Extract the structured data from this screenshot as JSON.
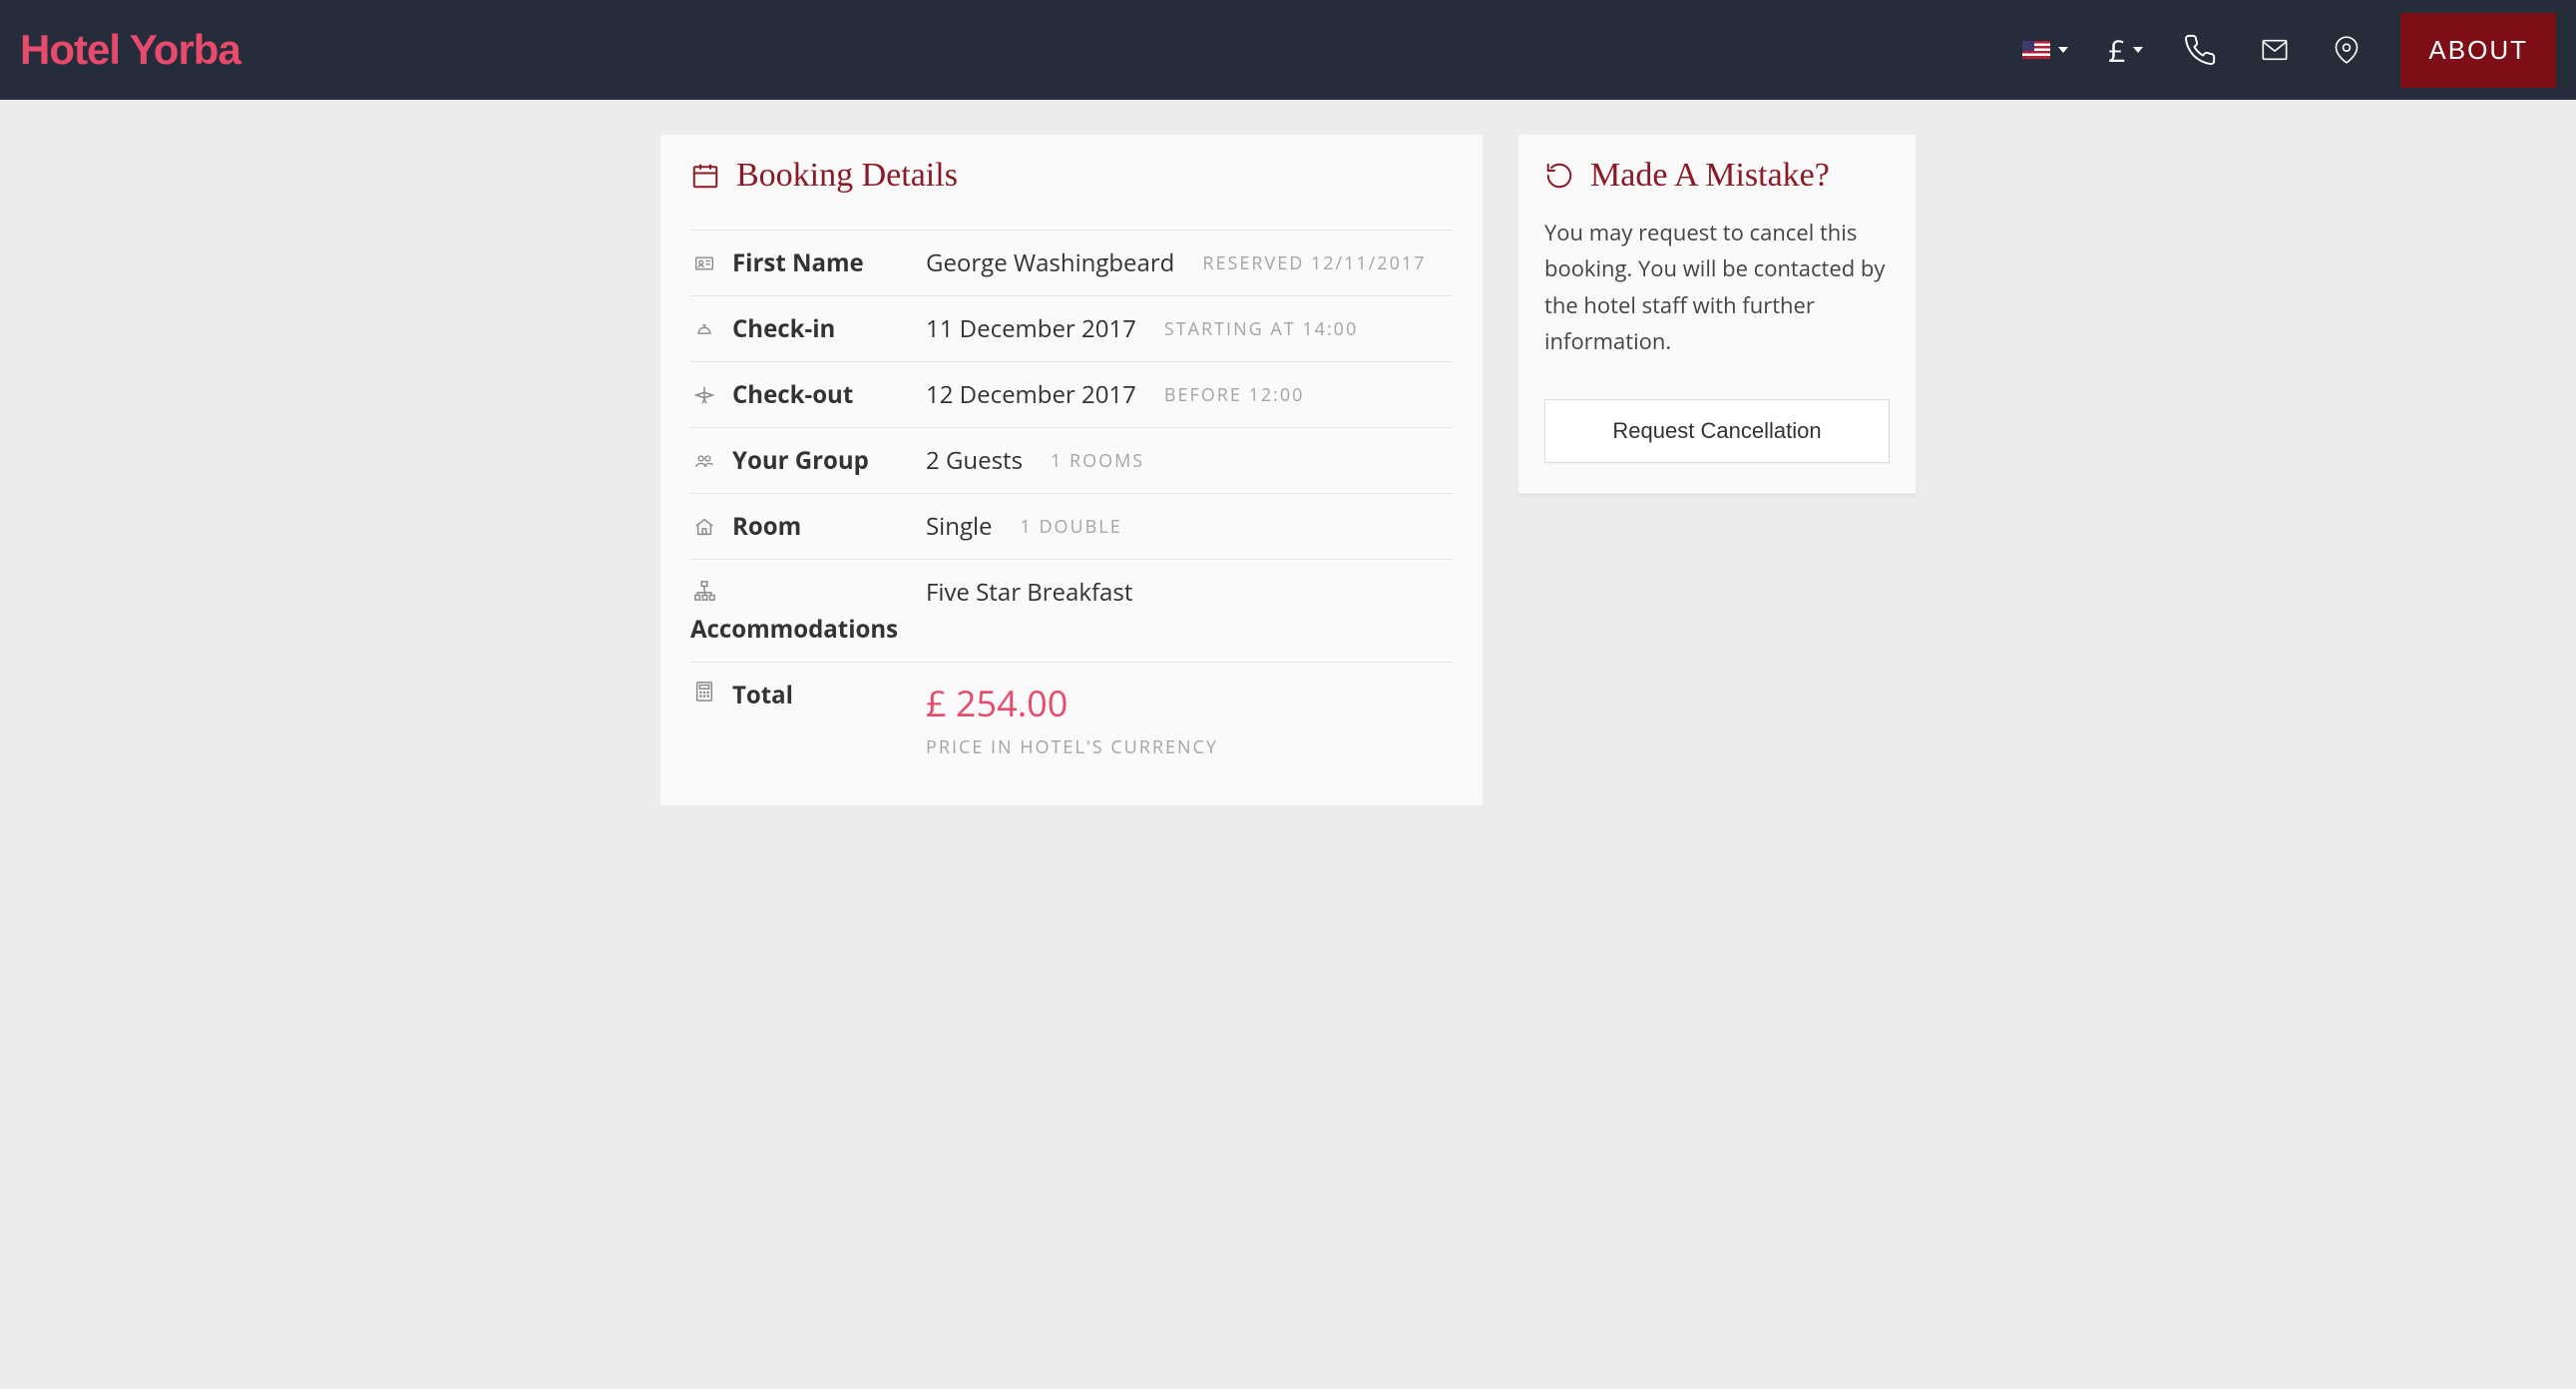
{
  "header": {
    "logo": "Hotel Yorba",
    "currency_symbol": "£",
    "about_label": "ABOUT"
  },
  "booking": {
    "title": "Booking Details",
    "rows": {
      "first_name": {
        "label": "First Name",
        "value": "George Washingbeard",
        "sub": "RESERVED 12/11/2017"
      },
      "check_in": {
        "label": "Check-in",
        "value": "11 December 2017",
        "sub": "STARTING AT 14:00"
      },
      "check_out": {
        "label": "Check-out",
        "value": "12 December 2017",
        "sub": "BEFORE 12:00"
      },
      "group": {
        "label": "Your Group",
        "value": "2 Guests",
        "sub": "1 ROOMS"
      },
      "room": {
        "label": "Room",
        "value": "Single",
        "sub": "1 DOUBLE"
      },
      "accommodations": {
        "label": "Accommodations",
        "value": "Five Star Breakfast"
      },
      "total": {
        "label": "Total",
        "value": "£ 254.00",
        "note": "PRICE IN HOTEL'S CURRENCY"
      }
    }
  },
  "mistake": {
    "title": "Made A Mistake?",
    "body": "You may request to cancel this booking. You will be contacted by the hotel staff with further information.",
    "button": "Request Cancellation"
  }
}
